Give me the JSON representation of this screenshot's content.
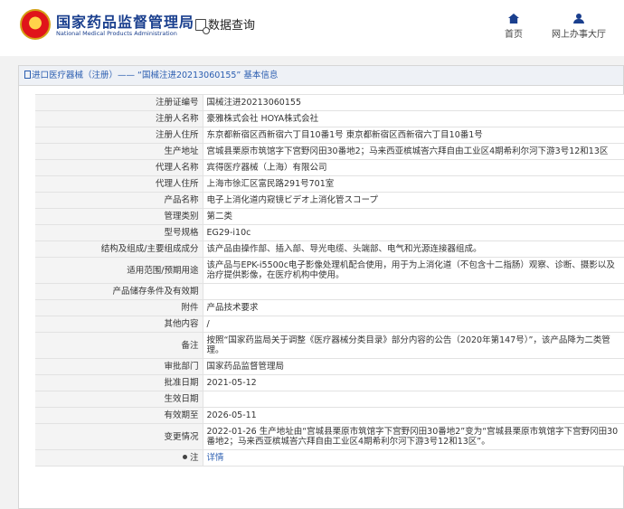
{
  "header": {
    "logo_cn": "国家药品监督管理局",
    "logo_en": "National Medical Products Administration",
    "query_label": "数据查询",
    "nav": [
      {
        "label": "首页",
        "icon": "home-icon"
      },
      {
        "label": "网上办事大厅",
        "icon": "user-icon"
      }
    ]
  },
  "breadcrumb": "进口医疗器械（注册）—— “国械注进20213060155” 基本信息",
  "rows": [
    {
      "label": "注册证编号",
      "value": "国械注进20213060155"
    },
    {
      "label": "注册人名称",
      "value": "豪雅株式会社 HOYA株式会社"
    },
    {
      "label": "注册人住所",
      "value": "东京都新宿区西新宿六丁目10番1号 東京都新宿区西新宿六丁目10番1号"
    },
    {
      "label": "生产地址",
      "value": "宫城县栗原市筑馆字下宫野冈田30番地2；马来西亚槟城峇六拜自由工业区4期希利尔河下游3号12和13区"
    },
    {
      "label": "代理人名称",
      "value": "宾得医疗器械（上海）有限公司"
    },
    {
      "label": "代理人住所",
      "value": "上海市徐汇区富民路291号701室"
    },
    {
      "label": "产品名称",
      "value": "电子上消化道内窥镜ビデオ上消化管スコープ"
    },
    {
      "label": "管理类别",
      "value": "第二类"
    },
    {
      "label": "型号规格",
      "value": "EG29-i10c"
    },
    {
      "label": "结构及组成/主要组成成分",
      "value": "该产品由操作部、插入部、导光电缆、头端部、电气和光源连接器组成。"
    },
    {
      "label": "适用范围/预期用途",
      "value": "该产品与EPK-i5500c电子影像处理机配合使用，用于为上消化道（不包含十二指肠）观察、诊断、摄影以及治疗提供影像，在医疗机构中使用。"
    },
    {
      "label": "产品储存条件及有效期",
      "value": ""
    },
    {
      "label": "附件",
      "value": "产品技术要求"
    },
    {
      "label": "其他内容",
      "value": "/"
    },
    {
      "label": "备注",
      "value": "按照“国家药监局关于调整《医疗器械分类目录》部分内容的公告（2020年第147号）”，该产品降为二类管理。"
    },
    {
      "label": "审批部门",
      "value": "国家药品监督管理局"
    },
    {
      "label": "批准日期",
      "value": "2021-05-12"
    },
    {
      "label": "生效日期",
      "value": ""
    },
    {
      "label": "有效期至",
      "value": "2026-05-11"
    },
    {
      "label": "变更情况",
      "value": "2022-01-26 生产地址由“宫城县栗原市筑馆字下宫野冈田30番地2”变为“宫城县栗原市筑馆字下宫野冈田30番地2；马来西亚槟城峇六拜自由工业区4期希利尔河下游3号12和13区”。"
    }
  ],
  "note": {
    "label": "注",
    "link": "详情"
  }
}
